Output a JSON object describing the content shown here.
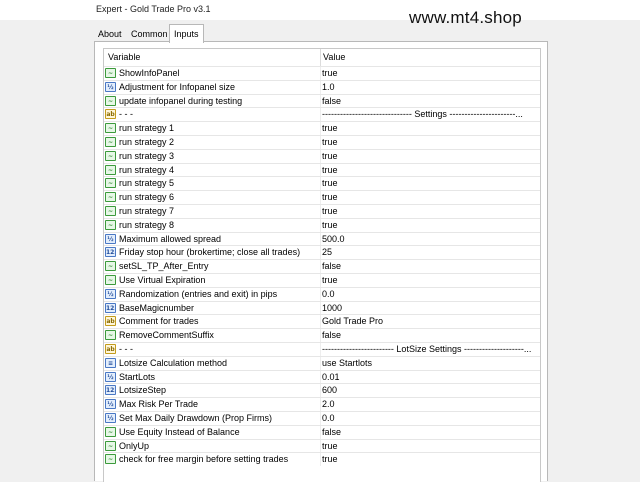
{
  "window": {
    "title": "Expert - Gold Trade Pro v3.1"
  },
  "watermark": "www.mt4.shop",
  "tabs": [
    {
      "label": "About",
      "active": false
    },
    {
      "label": "Common",
      "active": false
    },
    {
      "label": "Inputs",
      "active": true
    }
  ],
  "table": {
    "columns": [
      "Variable",
      "Value"
    ],
    "rows": [
      {
        "icon": "bool",
        "name": "ShowInfoPanel",
        "value": "true"
      },
      {
        "icon": "num",
        "name": "Adjustment for Infopanel size",
        "value": "1.0"
      },
      {
        "icon": "bool",
        "name": "update infopanel during testing",
        "value": "false"
      },
      {
        "icon": "str",
        "name": "- - -",
        "value": "------------------------------ Settings ----------------------..."
      },
      {
        "icon": "bool",
        "name": "run strategy 1",
        "value": "true"
      },
      {
        "icon": "bool",
        "name": "run strategy 2",
        "value": "true"
      },
      {
        "icon": "bool",
        "name": "run strategy 3",
        "value": "true"
      },
      {
        "icon": "bool",
        "name": "run strategy 4",
        "value": "true"
      },
      {
        "icon": "bool",
        "name": "run strategy 5",
        "value": "true"
      },
      {
        "icon": "bool",
        "name": "run strategy 6",
        "value": "true"
      },
      {
        "icon": "bool",
        "name": "run strategy 7",
        "value": "true"
      },
      {
        "icon": "bool",
        "name": "run strategy 8",
        "value": "true"
      },
      {
        "icon": "num",
        "name": "Maximum allowed spread",
        "value": "500.0"
      },
      {
        "icon": "int",
        "name": "Friday stop hour (brokertime; close all trades)",
        "value": "25"
      },
      {
        "icon": "bool",
        "name": "setSL_TP_After_Entry",
        "value": "false"
      },
      {
        "icon": "bool",
        "name": "Use Virtual Expiration",
        "value": "true"
      },
      {
        "icon": "num",
        "name": "Randomization (entries and exit) in pips",
        "value": "0.0"
      },
      {
        "icon": "int",
        "name": "BaseMagicnumber",
        "value": "1000"
      },
      {
        "icon": "str",
        "name": "Comment for trades",
        "value": "Gold Trade Pro"
      },
      {
        "icon": "bool",
        "name": "RemoveCommentSuffix",
        "value": "false"
      },
      {
        "icon": "str",
        "name": "- - -",
        "value": "------------------------ LotSize Settings --------------------..."
      },
      {
        "icon": "enum",
        "name": "Lotsize Calculation method",
        "value": "use Startlots"
      },
      {
        "icon": "num",
        "name": "StartLots",
        "value": "0.01"
      },
      {
        "icon": "int",
        "name": "LotsizeStep",
        "value": "600"
      },
      {
        "icon": "num",
        "name": "Max Risk Per Trade",
        "value": "2.0"
      },
      {
        "icon": "num",
        "name": "Set Max Daily Drawdown (Prop Firms)",
        "value": "0.0"
      },
      {
        "icon": "bool",
        "name": "Use Equity Instead of Balance",
        "value": "false"
      },
      {
        "icon": "bool",
        "name": "OnlyUp",
        "value": "true"
      },
      {
        "icon": "bool",
        "name": "check for free margin before setting trades",
        "value": "true"
      }
    ]
  }
}
